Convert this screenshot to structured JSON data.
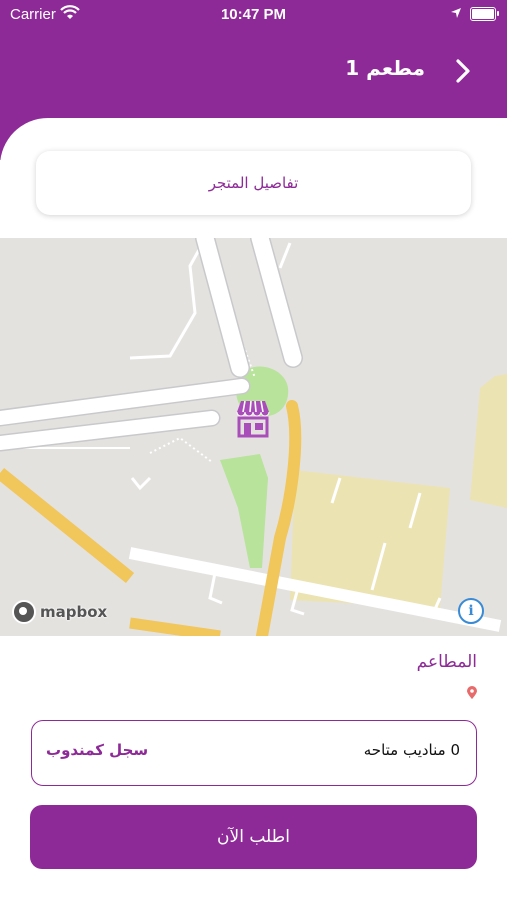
{
  "status_bar": {
    "carrier": "Carrier",
    "time": "10:47 PM"
  },
  "nav": {
    "title": "مطعم 1",
    "back_icon": "chevron-right-icon"
  },
  "store_details": {
    "label": "تفاصيل المتجر"
  },
  "map": {
    "attribution": "mapbox",
    "marker_icon": "store-icon",
    "info_icon": "info-icon"
  },
  "restaurant": {
    "name": "المطاعم",
    "pin_icon": "location-pin-icon"
  },
  "agents": {
    "count_text": "0 مناديب متاحه",
    "register_label": "سجل كمندوب"
  },
  "order_button": {
    "label": "اطلب الآن"
  },
  "colors": {
    "primary": "#8e2a97",
    "map_bg": "#e4e2df",
    "road_major": "#f1c65a",
    "park": "#b7e39a",
    "zone": "#ece3b3"
  }
}
